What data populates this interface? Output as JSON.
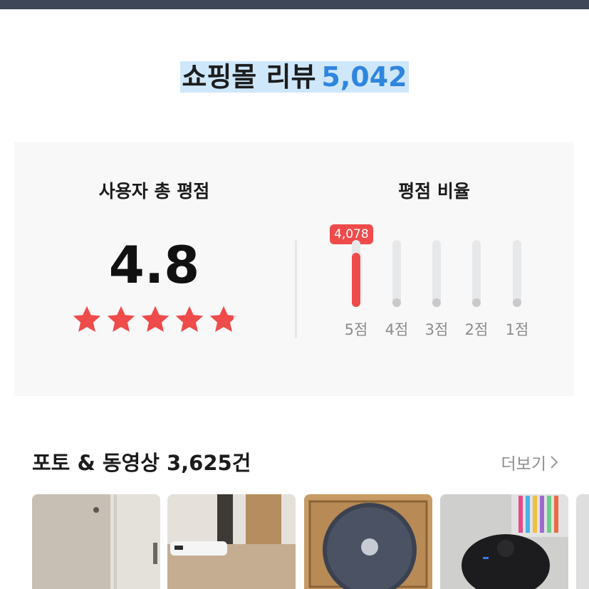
{
  "header": {
    "title": "쇼핑몰 리뷰",
    "count": "5,042"
  },
  "summary": {
    "score_title": "사용자 총 평점",
    "score": "4.8",
    "stars": {
      "rating": 4.8,
      "max": 5
    },
    "ratio_title": "평점 비율",
    "bars": [
      {
        "label": "5점",
        "tooltip": "4,078",
        "fill": 0.81
      },
      {
        "label": "4점",
        "fill": 0
      },
      {
        "label": "3점",
        "fill": 0
      },
      {
        "label": "2점",
        "fill": 0
      },
      {
        "label": "1점",
        "fill": 0
      }
    ]
  },
  "photos": {
    "title": "포토 & 동영상 3,625건",
    "more_label": "더보기"
  },
  "colors": {
    "accent_blue": "#2e86de",
    "star_red": "#ef4b4b",
    "highlight": "#cfe7fb"
  }
}
